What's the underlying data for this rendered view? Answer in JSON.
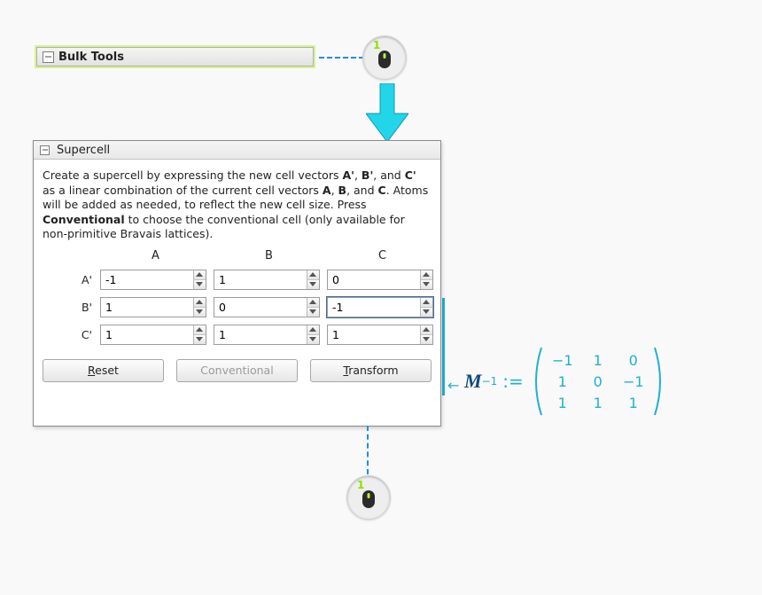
{
  "bulk_tools": {
    "label": "Bulk Tools"
  },
  "panel": {
    "title": "Supercell",
    "description_parts": {
      "t1": "Create a supercell by expressing the new cell vectors ",
      "b1": "A'",
      "t2": ", ",
      "b2": "B'",
      "t3": ", and ",
      "b3": "C'",
      "t4": " as a linear combination of the current cell vectors ",
      "b4": "A",
      "t5": ", ",
      "b5": "B",
      "t6": ", and ",
      "b6": "C",
      "t7": ". Atoms will be added as needed, to reflect the new cell size. Press ",
      "b7": "Conventional",
      "t8": " to choose the conventional cell (only available for non-primitive Bravais lattices)."
    },
    "columns": {
      "A": "A",
      "B": "B",
      "C": "C"
    },
    "rows": {
      "Ap": {
        "label": "A'",
        "A": "-1",
        "B": "1",
        "C": "0"
      },
      "Bp": {
        "label": "B'",
        "A": "1",
        "B": "0",
        "C": "-1"
      },
      "Cp": {
        "label": "C'",
        "A": "1",
        "B": "1",
        "C": "1"
      }
    },
    "buttons": {
      "reset": "Reset",
      "conventional": "Conventional",
      "transform": "Transform"
    }
  },
  "annotation": {
    "mouse_label": "1",
    "M": "M",
    "inv": "−1",
    "assign": ":=",
    "matrix": {
      "r1c1": "−1",
      "r1c2": "1",
      "r1c3": "0",
      "r2c1": "1",
      "r2c2": "0",
      "r2c3": "−1",
      "r3c1": "1",
      "r3c2": "1",
      "r3c3": "1"
    },
    "leftarrow": "←"
  }
}
